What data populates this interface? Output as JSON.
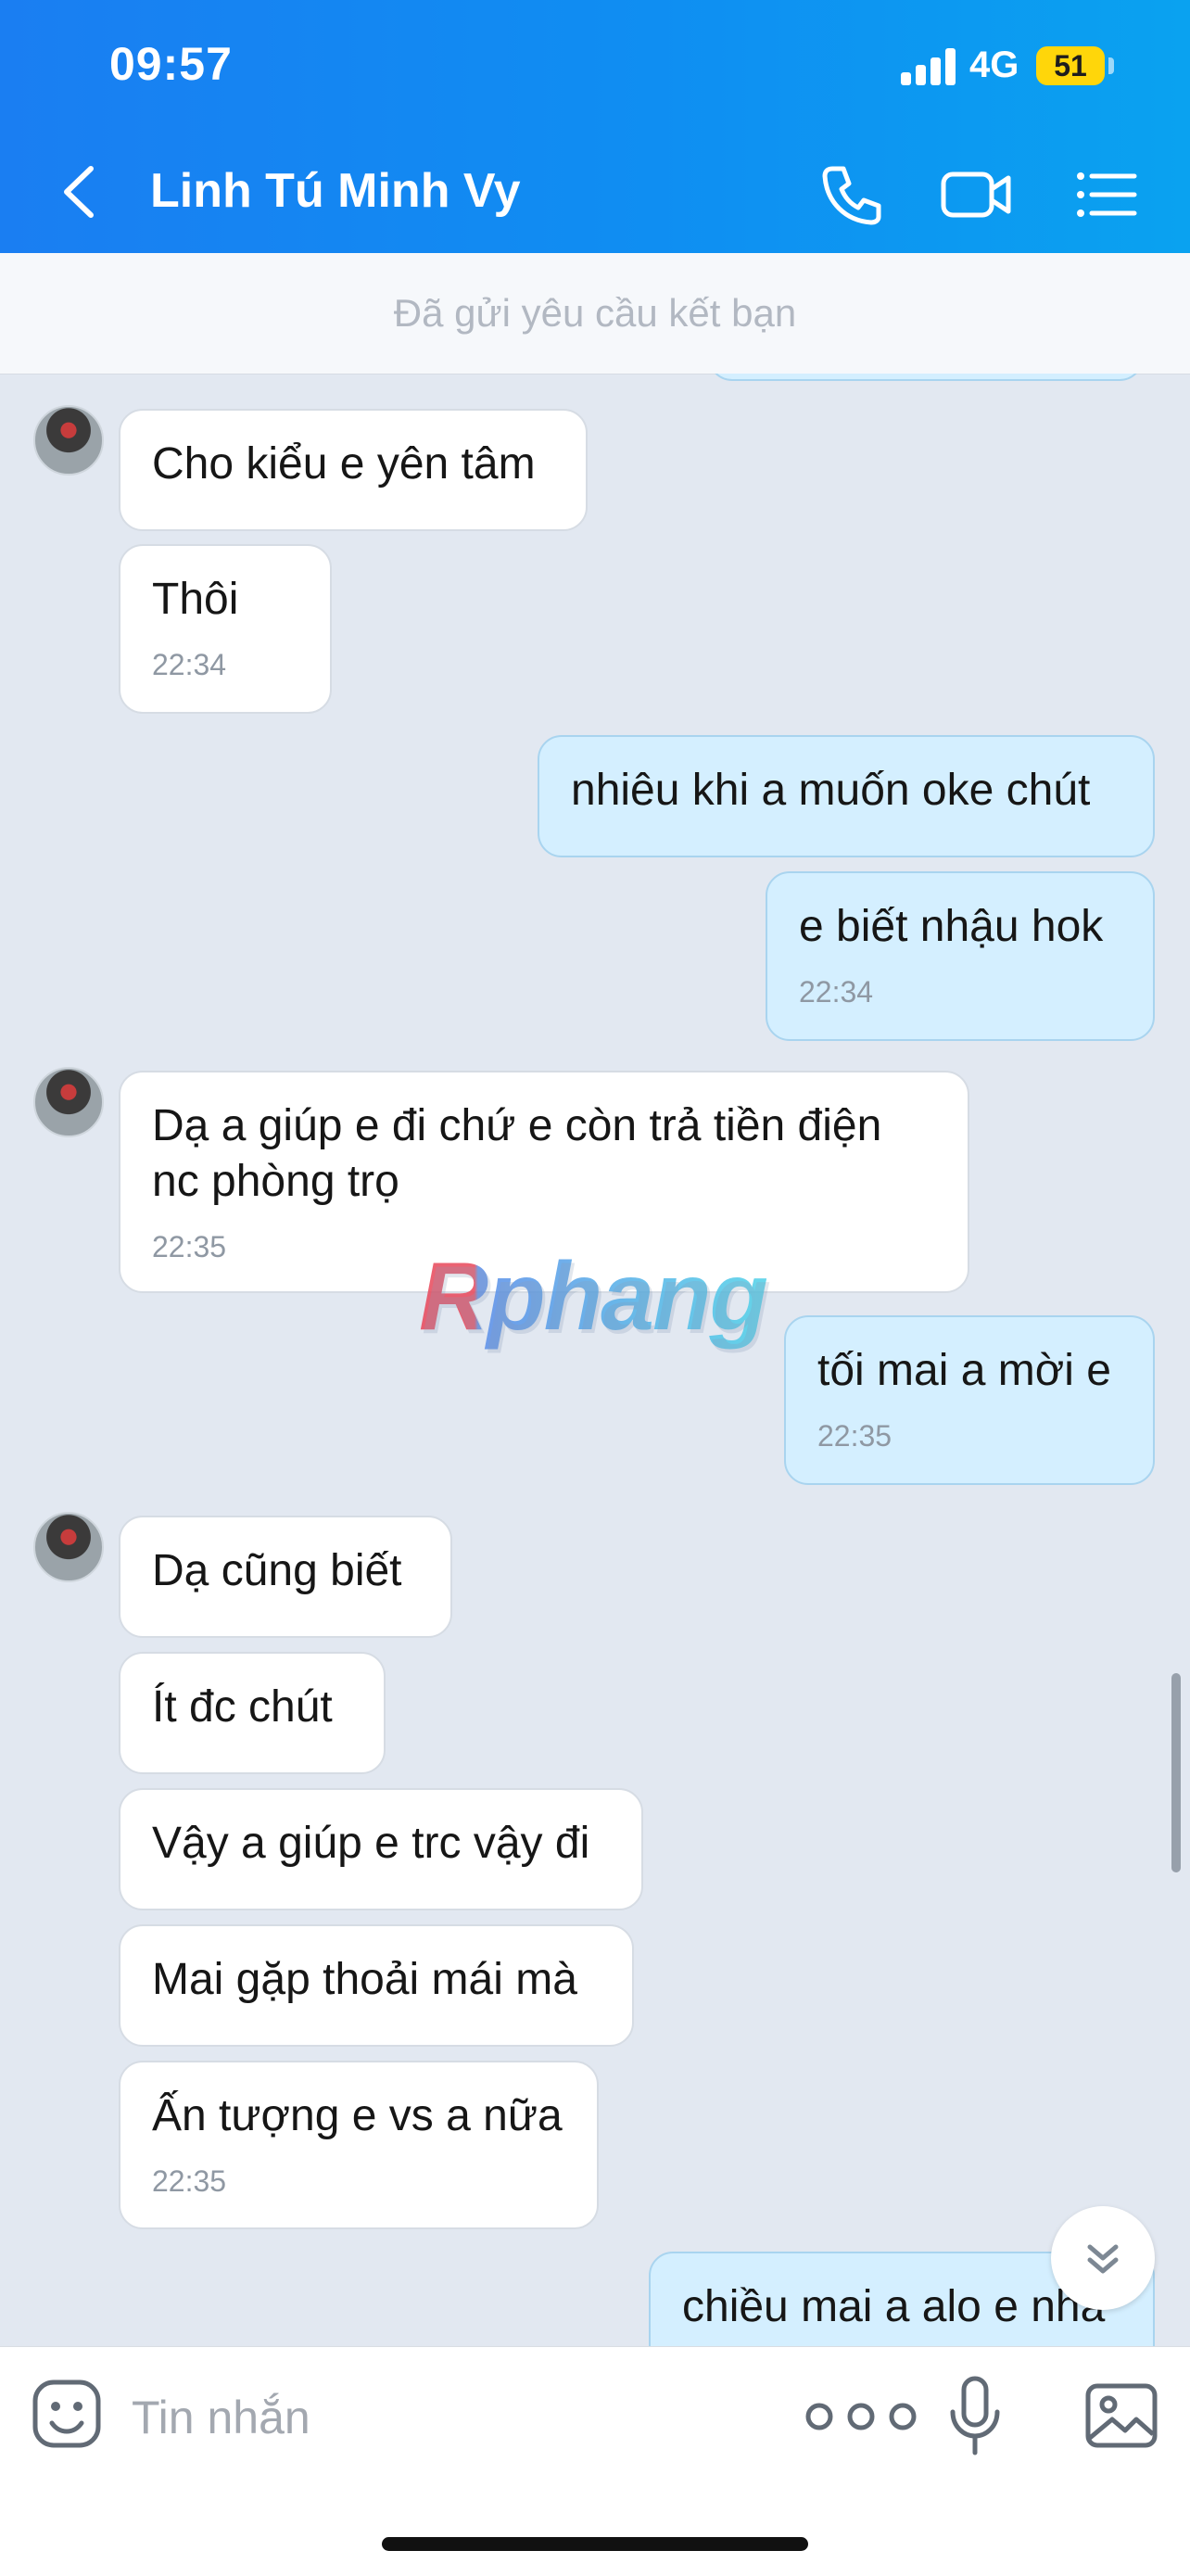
{
  "status_bar": {
    "time": "09:57",
    "network": "4G",
    "battery": "51"
  },
  "header": {
    "contact_name": "Linh Tú Minh Vy"
  },
  "friend_request_banner": "Đã gửi yêu cầu kết bạn",
  "messages": [
    {
      "direction": "in",
      "text": "Cho kiểu e yên tâm",
      "time": ""
    },
    {
      "direction": "in",
      "text": "Thôi",
      "time": "22:34"
    },
    {
      "direction": "out",
      "text": "nhiêu khi a muốn oke chút",
      "time": ""
    },
    {
      "direction": "out",
      "text": "e biết nhậu hok",
      "time": "22:34"
    },
    {
      "direction": "in",
      "text": "Dạ a giúp e đi chứ e còn trả tiền điện nc phòng trọ",
      "time": "22:35"
    },
    {
      "direction": "out",
      "text": "tối mai a mời e",
      "time": "22:35"
    },
    {
      "direction": "in",
      "text": "Dạ cũng biết",
      "time": ""
    },
    {
      "direction": "in",
      "text": "Ít đc chút",
      "time": ""
    },
    {
      "direction": "in",
      "text": "Vậy a giúp e trc vậy đi",
      "time": ""
    },
    {
      "direction": "in",
      "text": "Mai gặp thoải mái mà",
      "time": ""
    },
    {
      "direction": "in",
      "text": "Ấn tượng e vs a nữa",
      "time": "22:35"
    },
    {
      "direction": "out",
      "text": "chiều mai a alo e nha",
      "time": ""
    }
  ],
  "watermark": "Rphang",
  "composer": {
    "placeholder": "Tin nhắn"
  },
  "icons": [
    "back-arrow-icon",
    "phone-icon",
    "video-camera-icon",
    "list-menu-icon",
    "sticker-icon",
    "more-dots-icon",
    "microphone-icon",
    "image-icon",
    "chevron-double-down-icon"
  ]
}
